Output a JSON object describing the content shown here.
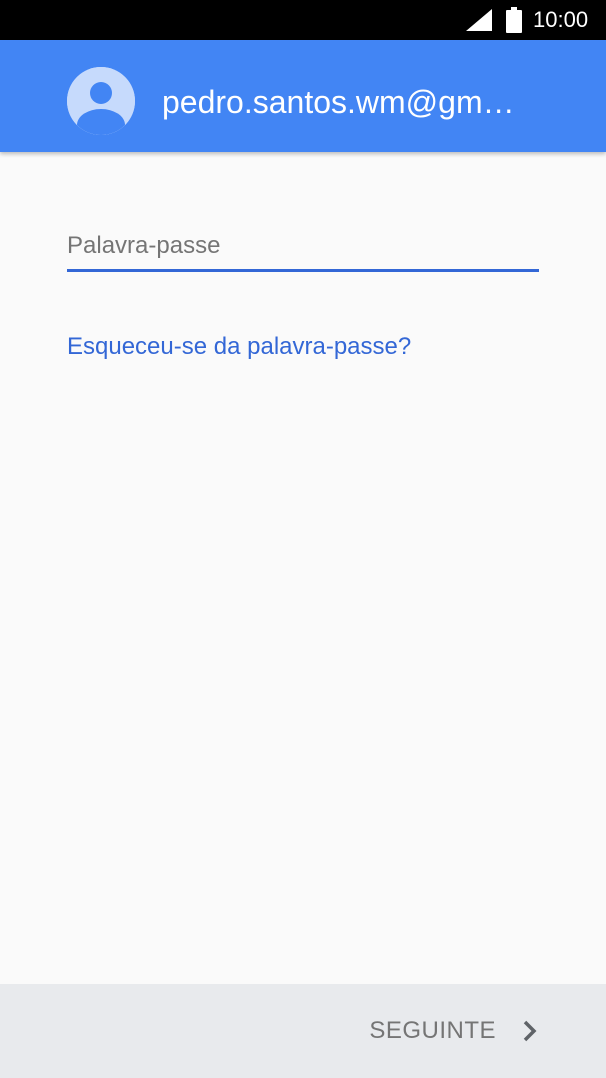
{
  "status_bar": {
    "time": "10:00",
    "signal_icon": "signal-icon",
    "battery_icon": "battery-icon"
  },
  "header": {
    "avatar_icon": "account-avatar-icon",
    "email": "pedro.santos.wm@gm…"
  },
  "form": {
    "password_placeholder": "Palavra-passe",
    "password_value": "",
    "forgot_password_label": "Esqueceu-se da palavra-passe?"
  },
  "footer": {
    "next_label": "SEGUINTE",
    "next_icon": "chevron-right-icon"
  },
  "colors": {
    "header_bg": "#4285f4",
    "accent": "#3367d6",
    "page_bg": "#fafafa",
    "footer_bg": "#e8eaed",
    "disabled_text": "#757575"
  }
}
